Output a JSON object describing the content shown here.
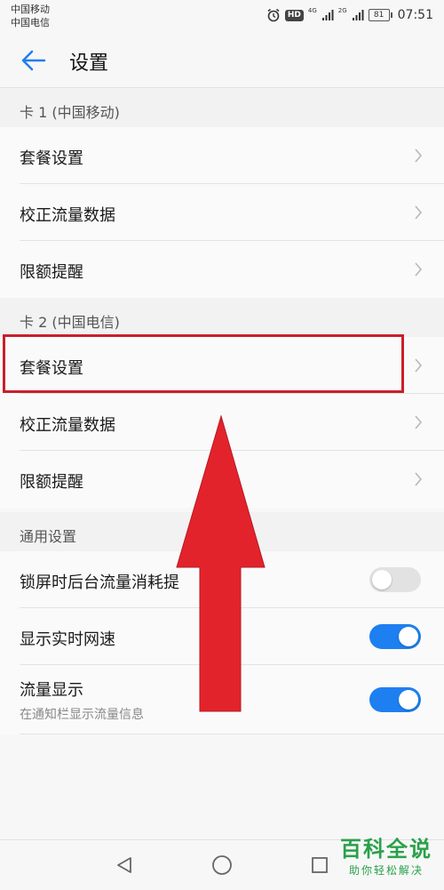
{
  "status_bar": {
    "carrier_1": "中国移动",
    "carrier_2": "中国电信",
    "hd": "HD",
    "net_1": "4G",
    "net_2": "2G",
    "battery": "81",
    "time": "07:51"
  },
  "header": {
    "title": "设置",
    "back_icon": "arrow-left-icon"
  },
  "sections": {
    "card1": {
      "title": "卡 1 (中国移动)",
      "items": [
        {
          "label": "套餐设置"
        },
        {
          "label": "校正流量数据"
        },
        {
          "label": "限额提醒"
        }
      ]
    },
    "card2": {
      "title": "卡 2 (中国电信)",
      "items": [
        {
          "label": "套餐设置"
        },
        {
          "label": "校正流量数据"
        },
        {
          "label": "限额提醒"
        }
      ]
    },
    "general": {
      "title": "通用设置",
      "items": [
        {
          "label": "锁屏时后台流量消耗提",
          "toggle": false
        },
        {
          "label": "显示实时网速",
          "toggle": true
        },
        {
          "label": "流量显示",
          "subtitle": "在通知栏显示流量信息",
          "toggle": true
        }
      ]
    }
  },
  "colors": {
    "accent": "#1e7ff0",
    "highlight": "#c8202a",
    "arrow": "#e3232c",
    "watermark": "#2aa14a"
  },
  "navigation": {
    "back": "triangle-back-icon",
    "home": "circle-home-icon",
    "recents": "square-recents-icon"
  },
  "watermark": {
    "title": "百科全说",
    "subtitle": "助你轻松解决"
  }
}
